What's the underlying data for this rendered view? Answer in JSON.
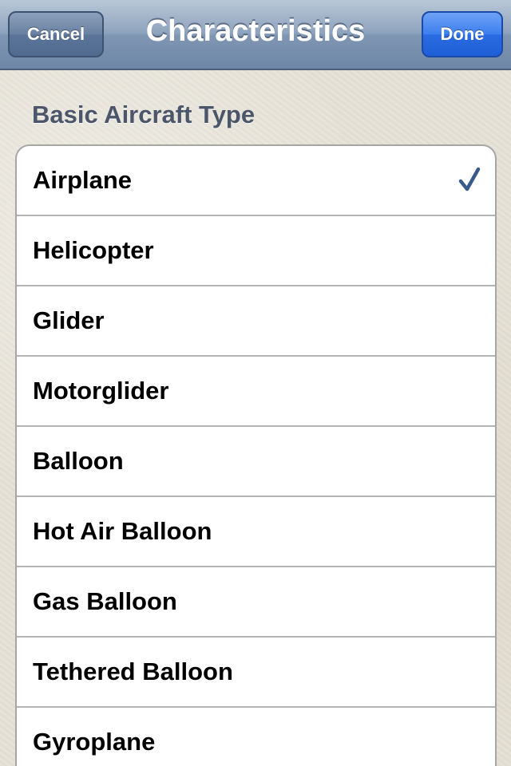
{
  "navbar": {
    "title": "Characteristics",
    "cancel_label": "Cancel",
    "done_label": "Done"
  },
  "section": {
    "header": "Basic Aircraft Type"
  },
  "items": [
    {
      "label": "Airplane",
      "selected": true
    },
    {
      "label": "Helicopter",
      "selected": false
    },
    {
      "label": "Glider",
      "selected": false
    },
    {
      "label": "Motorglider",
      "selected": false
    },
    {
      "label": "Balloon",
      "selected": false
    },
    {
      "label": "Hot Air Balloon",
      "selected": false
    },
    {
      "label": "Gas Balloon",
      "selected": false
    },
    {
      "label": "Tethered Balloon",
      "selected": false
    },
    {
      "label": "Gyroplane",
      "selected": false
    }
  ],
  "colors": {
    "checkmark": "#3a5a8c",
    "done_button": "#2a6be2",
    "navbar": "#8ea3bd"
  },
  "icons": {
    "selected_marker": "checkmark-icon"
  }
}
